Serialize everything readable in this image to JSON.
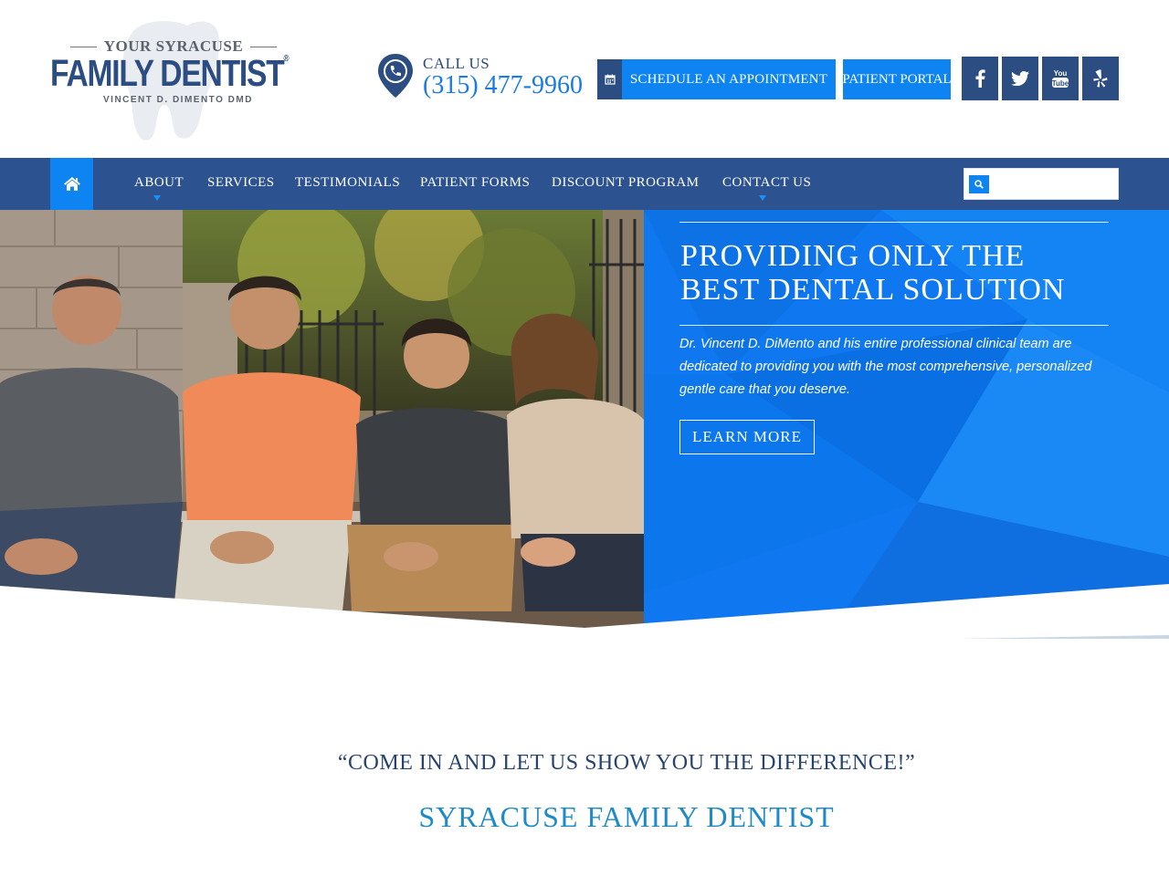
{
  "brand": {
    "top_line": "YOUR SYRACUSE",
    "main_line": "FAMILY DENTIST",
    "registered": "®",
    "sub_line": "VINCENT D. DIMENTO DMD"
  },
  "contact": {
    "call_label": "CALL US",
    "phone": "(315) 477-9960"
  },
  "buttons": {
    "schedule": "SCHEDULE AN APPOINTMENT",
    "portal": "PATIENT PORTAL"
  },
  "social": [
    {
      "name": "facebook-icon"
    },
    {
      "name": "twitter-icon"
    },
    {
      "name": "youtube-icon",
      "label_top": "You",
      "label_bottom": "Tube"
    },
    {
      "name": "yelp-icon"
    }
  ],
  "nav": {
    "items": [
      {
        "label": "ABOUT",
        "has_dropdown": true
      },
      {
        "label": "SERVICES",
        "has_dropdown": false
      },
      {
        "label": "TESTIMONIALS",
        "has_dropdown": false
      },
      {
        "label": "PATIENT FORMS",
        "has_dropdown": false
      },
      {
        "label": "DISCOUNT PROGRAM",
        "has_dropdown": false
      },
      {
        "label": "CONTACT US",
        "has_dropdown": true
      }
    ],
    "search_placeholder": ""
  },
  "hero": {
    "title": "PROVIDING ONLY THE BEST DENTAL SOLUTION",
    "text": "Dr. Vincent D. DiMento and his entire professional clinical team are dedicated to providing you with the most comprehensive, personalized gentle care that you deserve.",
    "button": "LEARN MORE"
  },
  "main": {
    "quote": "“COME IN AND LET US SHOW YOU THE DIFFERENCE!”",
    "subhead": "SYRACUSE FAMILY DENTIST"
  },
  "colors": {
    "navy": "#2b4d82",
    "accent_blue": "#0d84f2",
    "hero_blue": "#0f78f0",
    "subhead_blue": "#1f8ac9"
  }
}
